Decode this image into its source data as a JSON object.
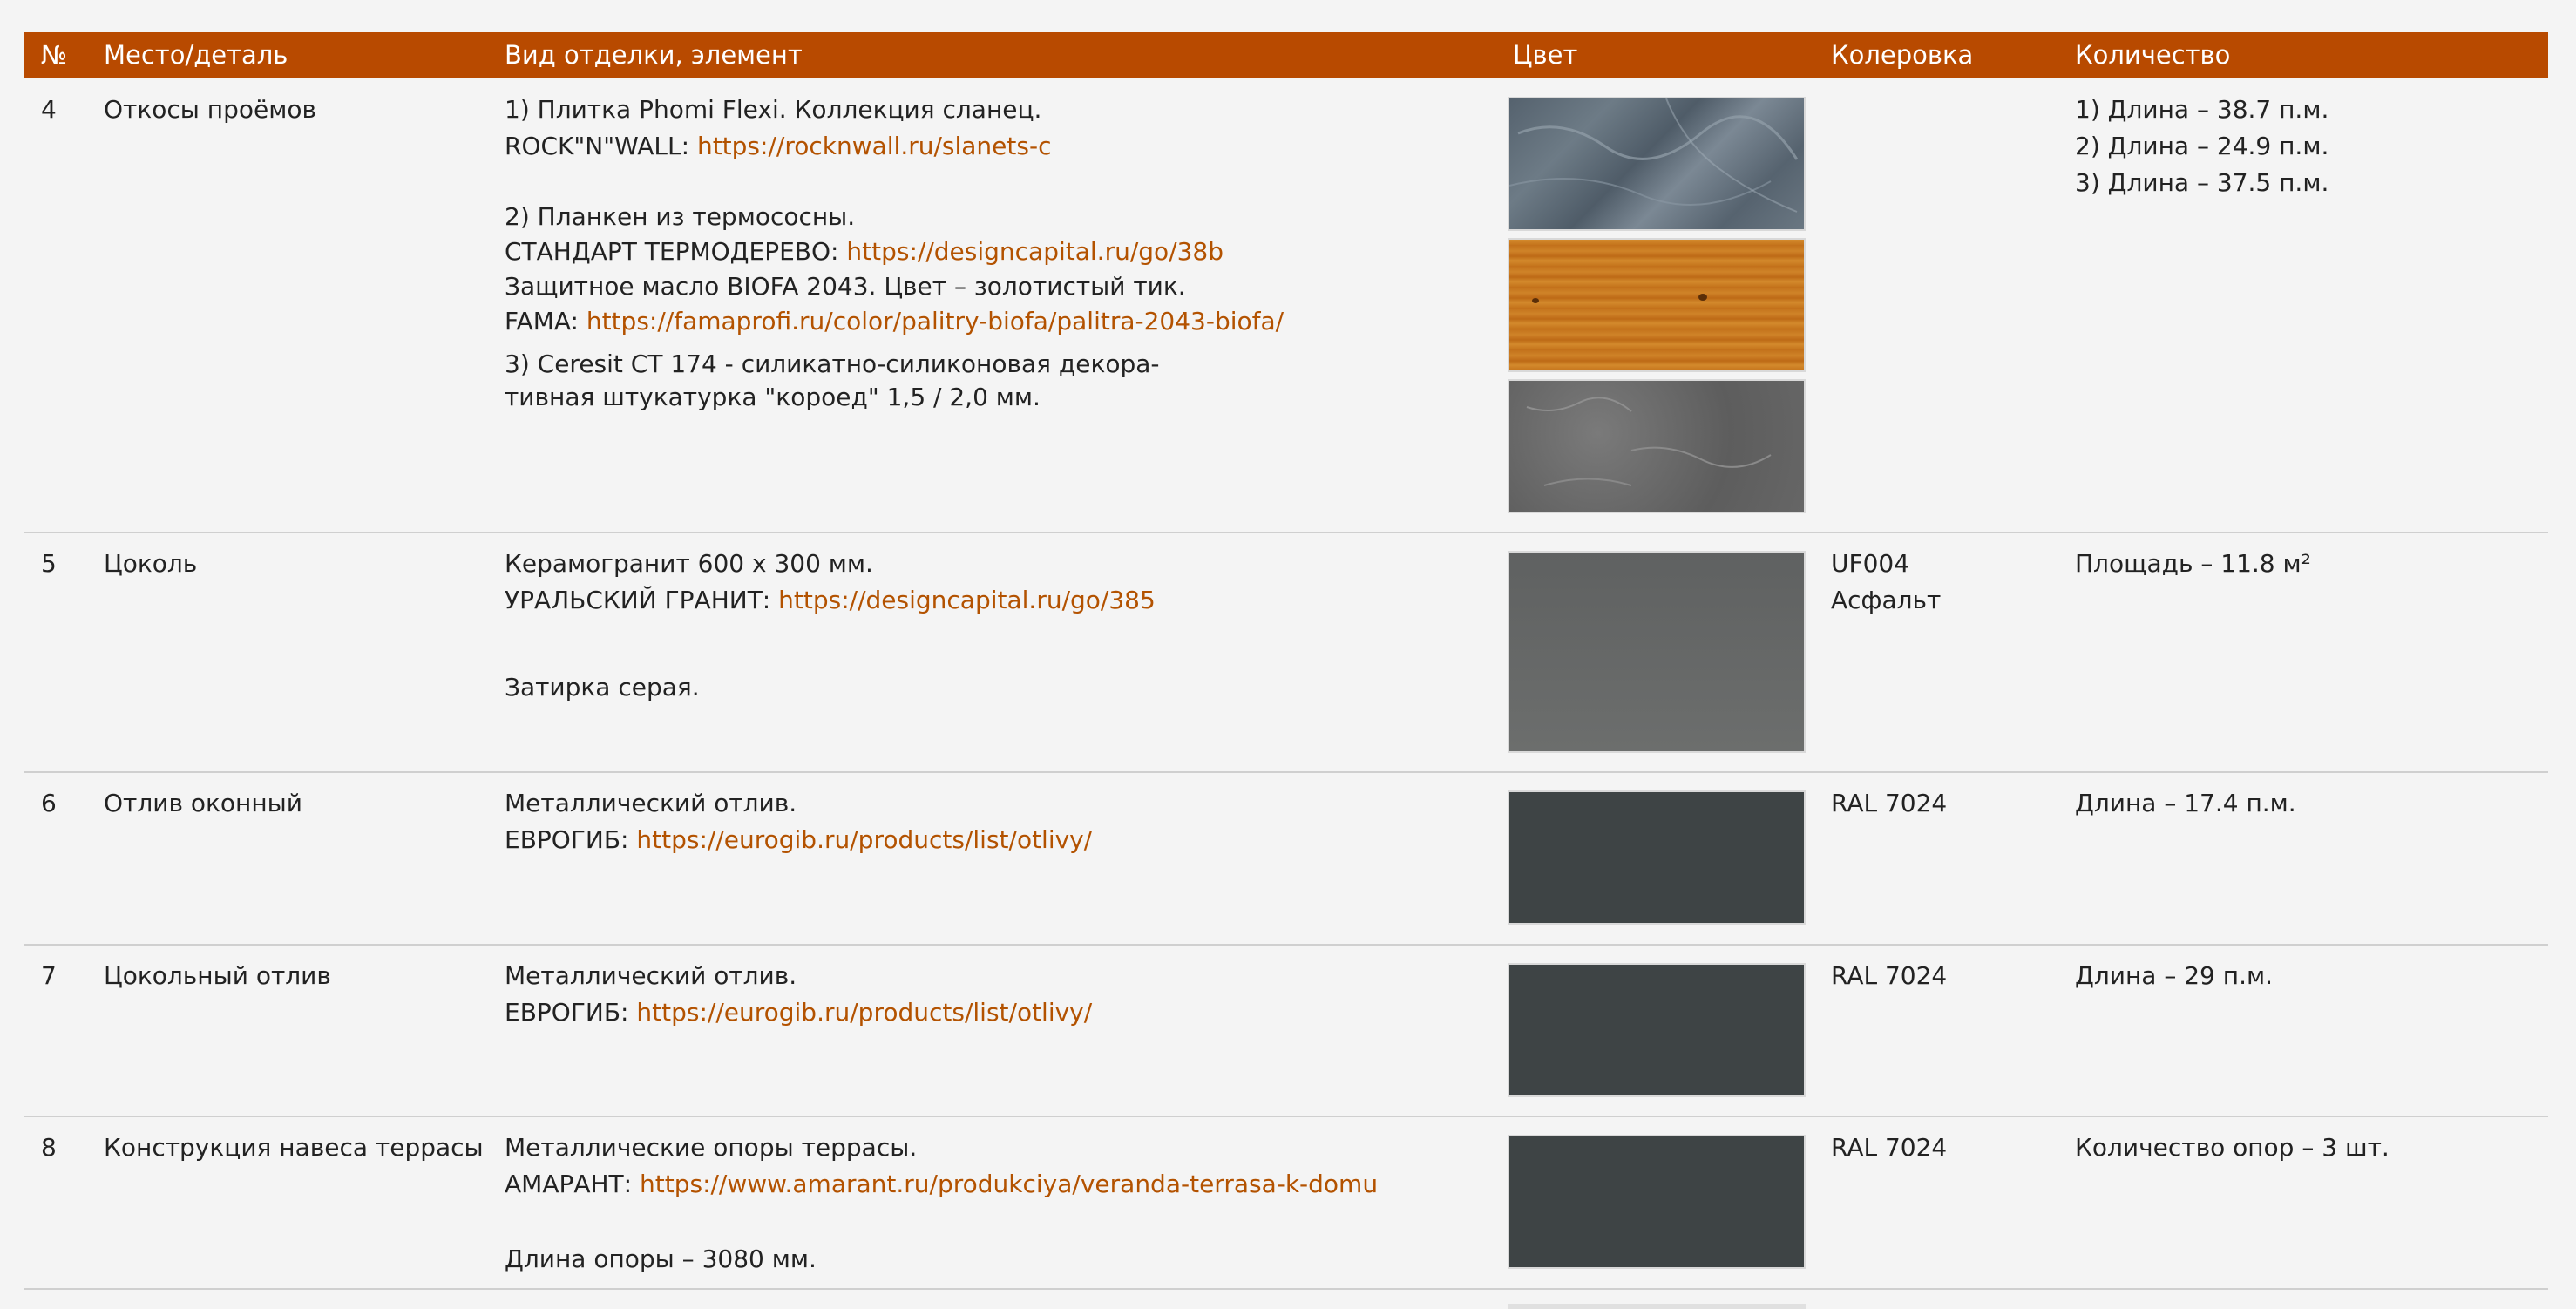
{
  "header": {
    "num": "№",
    "place": "Место/деталь",
    "finish": "Вид отделки, элемент",
    "color": "Цвет",
    "tint": "Колеровка",
    "qty": "Количество"
  },
  "rows": [
    {
      "num": "4",
      "place": "Откосы проёмов",
      "desc": {
        "l1": "1) Плитка Phomi Flexi. Коллекция сланец.",
        "l2_prefix": "ROCK\"N\"WALL: ",
        "l2_link": "https://rocknwall.ru/slanets-c",
        "l3": "2) Планкен из термососны.",
        "l4_prefix": "СТАНДАРТ ТЕРМОДЕРЕВО: ",
        "l4_link": "https://designcapital.ru/go/38b",
        "l5": "Защитное масло BIOFA 2043. Цвет – золотистый тик.",
        "l6_prefix": "FAMA: ",
        "l6_link": "https://famaprofi.ru/color/palitry-biofa/palitra-2043-biofa/",
        "l7": "3) Ceresit CT 174 - силикатно-силиконовая декора-",
        "l8": "тивная штукатурка \"короед\" 1,5 / 2,0 мм."
      },
      "swatches": [
        "slate-blue-gray",
        "golden-teak-wood",
        "gray-textured-plaster"
      ],
      "tint": "",
      "qty": [
        "1) Длина – 38.7 п.м.",
        "2) Длина – 24.9 п.м.",
        "3) Длина – 37.5 п.м."
      ]
    },
    {
      "num": "5",
      "place": "Цоколь",
      "desc": {
        "l1": "Керамогранит 600 х 300 мм.",
        "l2_prefix": "УРАЛЬСКИЙ ГРАНИТ: ",
        "l2_link": "https://designcapital.ru/go/385",
        "l3": "Затирка серая."
      },
      "swatch": "asphalt-gray",
      "tint_code": "UF004",
      "tint_name": "Асфальт",
      "qty": "Площадь – 11.8 м²"
    },
    {
      "num": "6",
      "place": "Отлив оконный",
      "desc": {
        "l1": "Металлический отлив.",
        "l2_prefix": "ЕВРОГИБ: ",
        "l2_link": "https://eurogib.ru/products/list/otlivy/"
      },
      "swatch": "ral-7024",
      "tint": "RAL 7024",
      "qty": "Длина – 17.4 п.м."
    },
    {
      "num": "7",
      "place": "Цокольный отлив",
      "desc": {
        "l1": "Металлический отлив.",
        "l2_prefix": "ЕВРОГИБ: ",
        "l2_link": "https://eurogib.ru/products/list/otlivy/"
      },
      "swatch": "ral-7024",
      "tint": "RAL 7024",
      "qty": "Длина – 29 п.м."
    },
    {
      "num": "8",
      "place": "Конструкция навеса террасы",
      "desc": {
        "l1": "Металлические опоры террасы.",
        "l2_prefix": "АМАРАНТ: ",
        "l2_link": "https://www.amarant.ru/produkciya/veranda-terrasa-k-domu",
        "l3": "Длина опоры – 3080 мм."
      },
      "swatch": "ral-7024",
      "tint": "RAL 7024",
      "qty": "Количество опор – 3 шт."
    }
  ],
  "colors": {
    "header_bg": "#b84a00",
    "link": "#b35200",
    "page_bg": "#f4f4f4",
    "divider": "#cfcfcf",
    "ral_7024": "#3e4445",
    "asphalt": "#6a6c6b"
  }
}
